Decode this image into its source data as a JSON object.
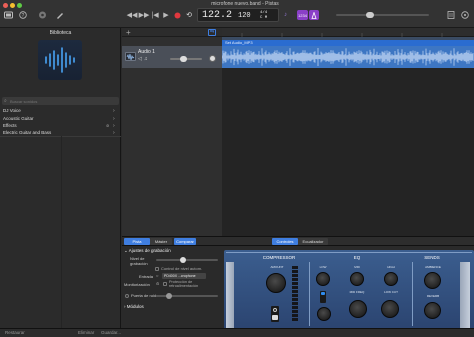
{
  "window": {
    "title": "microfone nuevo.band - Pistas"
  },
  "lcd": {
    "tempo_value": "122.2",
    "bpm": "120",
    "key_top": "4/4",
    "key_bottom": "C M"
  },
  "toolbar": {
    "count_in": "1234",
    "zoom_text": "⚡"
  },
  "library": {
    "title": "Biblioteca",
    "search_placeholder": "Buscar sonidos",
    "items": [
      "DJ Voice",
      "Acoustic Guitar",
      "Effects",
      "Electric Guitar and Bass"
    ],
    "footer_left": "Restaurar",
    "footer_mid": "Eliminar",
    "footer_right": "Guardar..."
  },
  "track": {
    "name": "Audio 1",
    "region_name": "Set Audio_MP3"
  },
  "smart_controls": {
    "tabs": [
      "Pista",
      "Máster",
      "Comparar"
    ],
    "active_tab": "Comparar",
    "view_tabs": [
      "Controles",
      "Ecualizador"
    ]
  },
  "inspector": {
    "section": "Ajustes de grabación",
    "rows": [
      "Nivel de grabación",
      "Control de nivel autom.",
      "Entrada",
      "Monitorización",
      "Protección de retroalimentación",
      "Puerta de ruido",
      "Módulos"
    ],
    "input_value": "PD400X ...crophone"
  },
  "plugin": {
    "sections": [
      "COMPRESSOR",
      "EQ",
      "SENDS"
    ],
    "labels": {
      "amount": "AMOUNT",
      "low": "LOW",
      "mid": "MID",
      "high": "HIGH",
      "ambience": "AMBIENCE",
      "mid_freq": "MID FREQ",
      "low_cut": "LOW CUT",
      "high_cut": "HIGH CUT",
      "reverb": "REVERB"
    }
  },
  "colors": {
    "accent": "#3f7ee0",
    "region": "#3d76c3",
    "plugin_top": "#3b5e8f",
    "record": "#e0383e"
  }
}
